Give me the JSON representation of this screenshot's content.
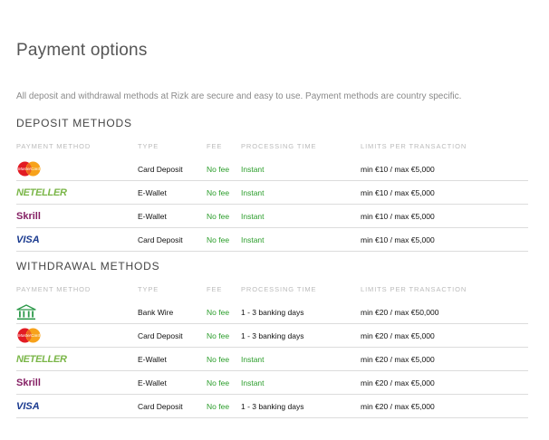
{
  "page": {
    "title": "Payment options",
    "intro": "All deposit and withdrawal methods at Rizk are secure and easy to use. Payment methods are country specific."
  },
  "deposit": {
    "heading": "DEPOSIT METHODS",
    "columns": [
      "PAYMENT METHOD",
      "TYPE",
      "FEE",
      "PROCESSING TIME",
      "LIMITS PER TRANSACTION"
    ],
    "rows": [
      {
        "logo": "mastercard",
        "type": "Card Deposit",
        "fee": "No fee",
        "time": "Instant",
        "limits": "min €10 / max €5,000"
      },
      {
        "logo": "neteller",
        "logo_text": "NETELLER",
        "type": "E-Wallet",
        "fee": "No fee",
        "time": "Instant",
        "limits": "min €10 / max €5,000"
      },
      {
        "logo": "skrill",
        "logo_text": "Skrill",
        "type": "E-Wallet",
        "fee": "No fee",
        "time": "Instant",
        "limits": "min €10 / max €5,000"
      },
      {
        "logo": "visa",
        "logo_text": "VISA",
        "type": "Card Deposit",
        "fee": "No fee",
        "time": "Instant",
        "limits": "min €10 / max €5,000"
      }
    ]
  },
  "withdrawal": {
    "heading": "WITHDRAWAL METHODS",
    "columns": [
      "PAYMENT METHOD",
      "TYPE",
      "FEE",
      "PROCESSING TIME",
      "LIMITS PER TRANSACTION"
    ],
    "rows": [
      {
        "logo": "bank",
        "type": "Bank Wire",
        "fee": "No fee",
        "time": "1 - 3 banking days",
        "limits": "min €20 / max €50,000"
      },
      {
        "logo": "mastercard",
        "type": "Card Deposit",
        "fee": "No fee",
        "time": "1 - 3 banking days",
        "limits": "min €20 / max €5,000"
      },
      {
        "logo": "neteller",
        "logo_text": "NETELLER",
        "type": "E-Wallet",
        "fee": "No fee",
        "time": "Instant",
        "limits": "min €20 / max €5,000"
      },
      {
        "logo": "skrill",
        "logo_text": "Skrill",
        "type": "E-Wallet",
        "fee": "No fee",
        "time": "Instant",
        "limits": "min €20 / max €5,000"
      },
      {
        "logo": "visa",
        "logo_text": "VISA",
        "type": "Card Deposit",
        "fee": "No fee",
        "time": "1 - 3 banking days",
        "limits": "min €20 / max €5,000"
      }
    ]
  },
  "colors": {
    "fee_green": "#2a9d2a",
    "neteller_green": "#7ab648",
    "skrill_purple": "#862165",
    "visa_blue": "#1a3a8f",
    "bank_green": "#2e9a4b"
  }
}
